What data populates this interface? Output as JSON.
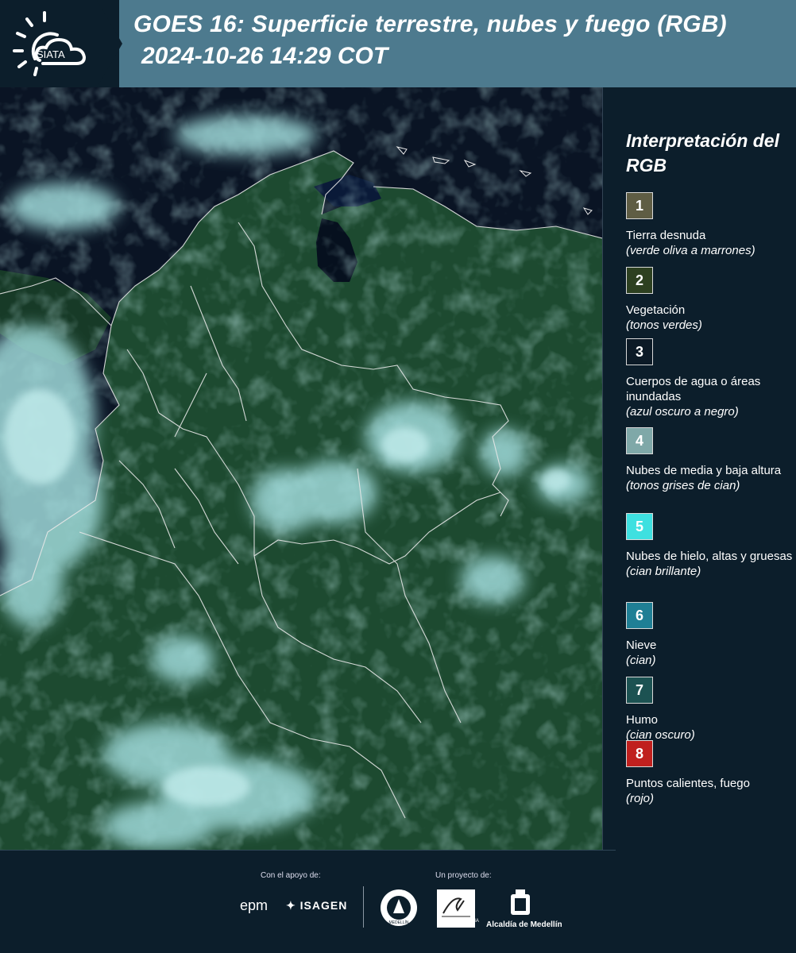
{
  "header": {
    "brand": "SIATA",
    "title_line1": "GOES 16: Superficie terrestre, nubes y fuego (RGB)",
    "title_line2": "2024-10-26 14:29 COT"
  },
  "map": {
    "icon": "satellite-map",
    "colors": {
      "vegetation": "#1f4a30",
      "clouds": "#8ed6d6",
      "water": "#0b1a33",
      "borders": "#e6e6e6"
    }
  },
  "legend": {
    "title": "Interpretación del RGB",
    "items": [
      {
        "num": "1",
        "color": "#5f5d44",
        "label": "Tierra desnuda",
        "desc": "(verde oliva a marrones)"
      },
      {
        "num": "2",
        "color": "#2d4020",
        "label": "Vegetación",
        "desc": "(tonos verdes)"
      },
      {
        "num": "3",
        "color": "#0c1a26",
        "label": "Cuerpos de agua o áreas inundadas",
        "desc": "(azul oscuro a negro)"
      },
      {
        "num": "4",
        "color": "#7fa8a8",
        "label": "Nubes de media y baja altura",
        "desc": "(tonos grises de cian)"
      },
      {
        "num": "5",
        "color": "#3ee0e0",
        "label": "Nubes de hielo, altas y gruesas",
        "desc": "(cian brillante)"
      },
      {
        "num": "6",
        "color": "#1f7f95",
        "label": "Nieve",
        "desc": "(cian)"
      },
      {
        "num": "7",
        "color": "#1c5252",
        "label": "Humo",
        "desc": "(cian oscuro)"
      },
      {
        "num": "8",
        "color": "#c0201e",
        "label": "Puntos calientes, fuego",
        "desc": "(rojo)"
      }
    ]
  },
  "footer": {
    "support_label": "Con el apoyo de:",
    "project_label": "Un proyecto de:",
    "sponsors": [
      "epm",
      "ISAGEN"
    ],
    "seal_text": "MEDELLÍN",
    "area_text": "METROPOLITANA",
    "alcaldia": "Alcaldía de Medellín"
  }
}
